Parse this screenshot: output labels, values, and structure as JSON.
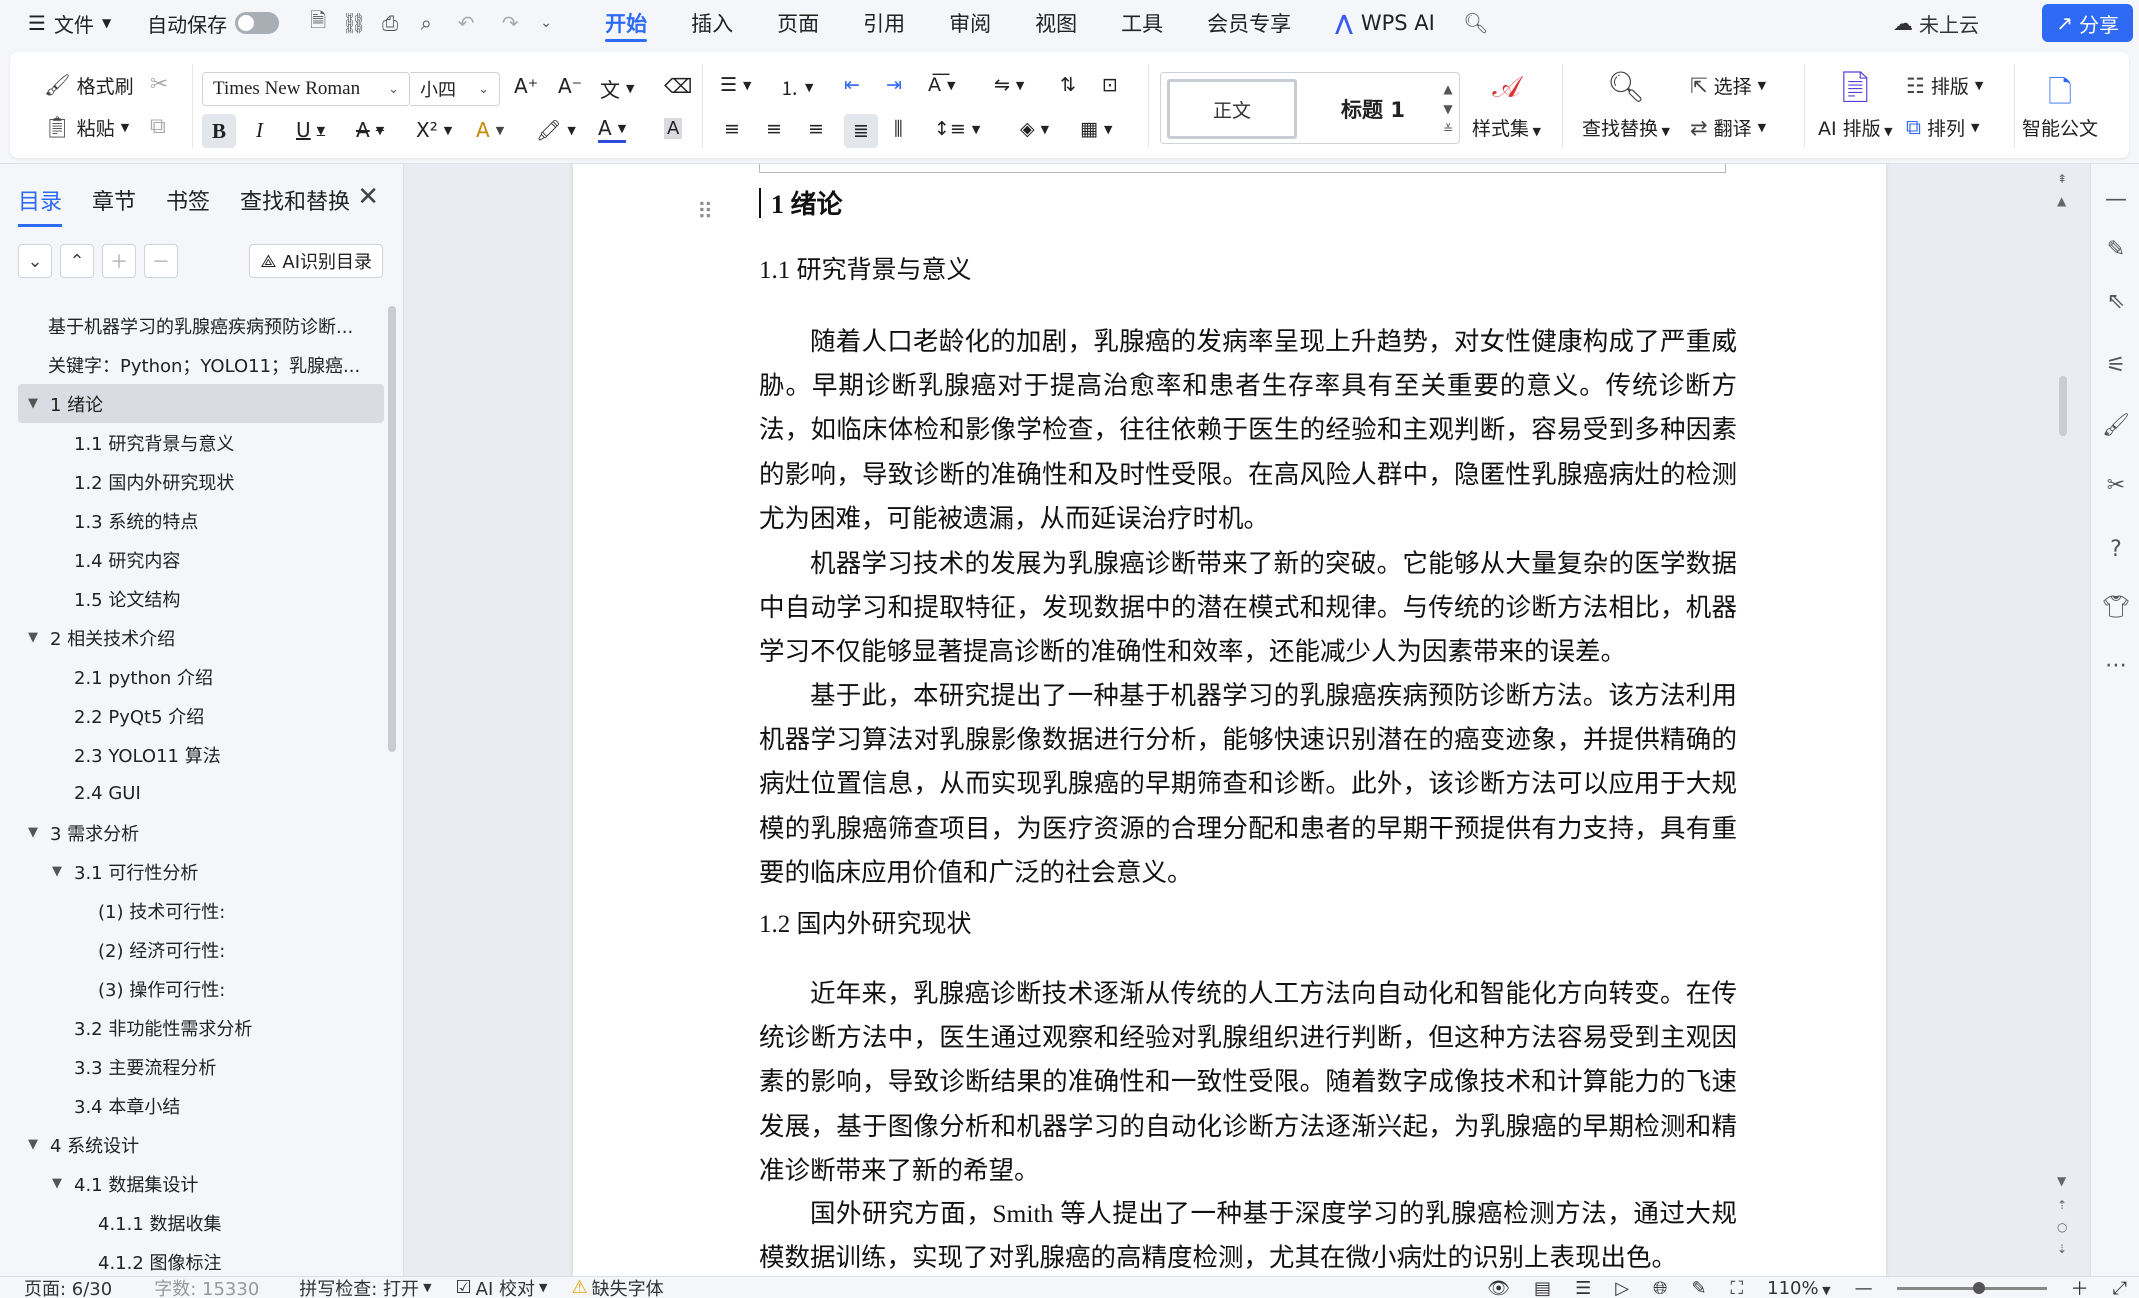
{
  "menubar": {
    "file_label": "文件",
    "autosave_label": "自动保存",
    "tabs": [
      {
        "label": "开始",
        "active": true
      },
      {
        "label": "插入"
      },
      {
        "label": "页面"
      },
      {
        "label": "引用"
      },
      {
        "label": "审阅"
      },
      {
        "label": "视图"
      },
      {
        "label": "工具"
      },
      {
        "label": "会员专享"
      },
      {
        "label": "WPS AI"
      }
    ],
    "cloud_label": "未上云",
    "share_label": "分享"
  },
  "ribbon": {
    "format_painter": "格式刷",
    "paste": "粘贴",
    "font_name": "Times New Roman",
    "font_size": "小四",
    "style_normal": "正文",
    "style_heading1": "标题 1",
    "style_set": "样式集",
    "find_replace": "查找替换",
    "select": "选择",
    "translate": "翻译",
    "ai_layout": "AI 排版",
    "layout": "排版",
    "arrange": "排列",
    "smart_doc": "智能公文"
  },
  "nav": {
    "tabs": [
      "目录",
      "章节",
      "书签",
      "查找和替换"
    ],
    "ai_toc_label": "AI识别目录",
    "toc": [
      {
        "text": "基于机器学习的乳腺癌疾病预防诊断...",
        "level": 0,
        "arrow": ""
      },
      {
        "text": "关键字：Python；YOLO11；乳腺癌...",
        "level": 0,
        "arrow": ""
      },
      {
        "text": "1 绪论",
        "level": 0,
        "arrow": "▼",
        "selected": true
      },
      {
        "text": "1.1 研究背景与意义",
        "level": 1,
        "arrow": ""
      },
      {
        "text": "1.2 国内外研究现状",
        "level": 1,
        "arrow": ""
      },
      {
        "text": "1.3 系统的特点",
        "level": 1,
        "arrow": ""
      },
      {
        "text": "1.4 研究内容",
        "level": 1,
        "arrow": ""
      },
      {
        "text": "1.5 论文结构",
        "level": 1,
        "arrow": ""
      },
      {
        "text": "2 相关技术介绍",
        "level": 0,
        "arrow": "▼"
      },
      {
        "text": "2.1 python 介绍",
        "level": 1,
        "arrow": ""
      },
      {
        "text": "2.2 PyQt5 介绍",
        "level": 1,
        "arrow": ""
      },
      {
        "text": "2.3 YOLO11 算法",
        "level": 1,
        "arrow": ""
      },
      {
        "text": "2.4 GUI",
        "level": 1,
        "arrow": ""
      },
      {
        "text": "3 需求分析",
        "level": 0,
        "arrow": "▼"
      },
      {
        "text": "3.1 可行性分析",
        "level": 1,
        "arrow": "▼"
      },
      {
        "text": "(1) 技术可行性:",
        "level": 2,
        "arrow": ""
      },
      {
        "text": "(2) 经济可行性:",
        "level": 2,
        "arrow": ""
      },
      {
        "text": "(3) 操作可行性:",
        "level": 2,
        "arrow": ""
      },
      {
        "text": "3.2 非功能性需求分析",
        "level": 1,
        "arrow": ""
      },
      {
        "text": "3.3 主要流程分析",
        "level": 1,
        "arrow": ""
      },
      {
        "text": "3.4 本章小结",
        "level": 1,
        "arrow": ""
      },
      {
        "text": "4 系统设计",
        "level": 0,
        "arrow": "▼"
      },
      {
        "text": "4.1 数据集设计",
        "level": 1,
        "arrow": "▼"
      },
      {
        "text": "4.1.1 数据收集",
        "level": 2,
        "arrow": ""
      },
      {
        "text": "4.1.2 图像标注",
        "level": 2,
        "arrow": ""
      }
    ]
  },
  "document": {
    "h1": "1  绪论",
    "h2_1": "1.1 研究背景与意义",
    "p1": "随着人口老龄化的加剧，乳腺癌的发病率呈现上升趋势，对女性健康构成了严重威胁。早期诊断乳腺癌对于提高治愈率和患者生存率具有至关重要的意义。传统诊断方法，如临床体检和影像学检查，往往依赖于医生的经验和主观判断，容易受到多种因素的影响，导致诊断的准确性和及时性受限。在高风险人群中，隐匿性乳腺癌病灶的检测尤为困难，可能被遗漏，从而延误治疗时机。",
    "p2": "机器学习技术的发展为乳腺癌诊断带来了新的突破。它能够从大量复杂的医学数据中自动学习和提取特征，发现数据中的潜在模式和规律。与传统的诊断方法相比，机器学习不仅能够显著提高诊断的准确性和效率，还能减少人为因素带来的误差。",
    "p3": "基于此，本研究提出了一种基于机器学习的乳腺癌疾病预防诊断方法。该方法利用机器学习算法对乳腺影像数据进行分析，能够快速识别潜在的癌变迹象，并提供精确的病灶位置信息，从而实现乳腺癌的早期筛查和诊断。此外，该诊断方法可以应用于大规模的乳腺癌筛查项目，为医疗资源的合理分配和患者的早期干预提供有力支持，具有重要的临床应用价值和广泛的社会意义。",
    "h2_2": "1.2 国内外研究现状",
    "p4": "近年来，乳腺癌诊断技术逐渐从传统的人工方法向自动化和智能化方向转变。在传统诊断方法中，医生通过观察和经验对乳腺组织进行判断，但这种方法容易受到主观因素的影响，导致诊断结果的准确性和一致性受限。随着数字成像技术和计算能力的飞速发展，基于图像分析和机器学习的自动化诊断方法逐渐兴起，为乳腺癌的早期检测和精准诊断带来了新的希望。",
    "p5": "国外研究方面，Smith 等人提出了一种基于深度学习的乳腺癌检测方法，通过大规模数据训练，实现了对乳腺癌的高精度检测，尤其在微小病灶的识别上表现出色。"
  },
  "statusbar": {
    "page": "页面: 6/30",
    "words": "字数: 15330",
    "spellcheck": "拼写检查: 打开",
    "ai_proof": "AI 校对",
    "missing_font": "缺失字体",
    "zoom": "110%"
  }
}
